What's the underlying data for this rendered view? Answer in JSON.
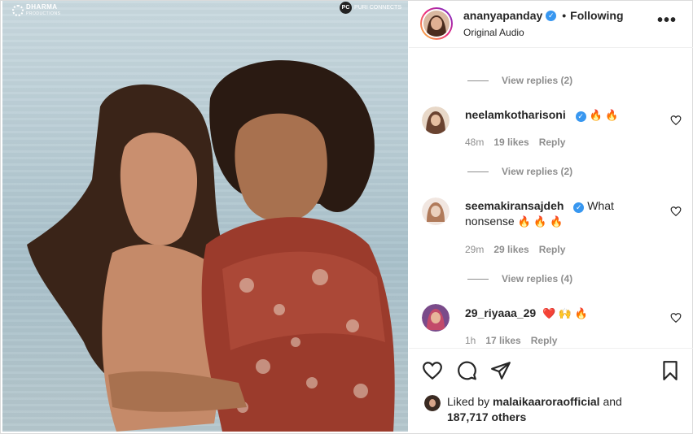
{
  "media": {
    "logo_left": "DHARMA",
    "logo_left_sub": "PRODUCTIONS",
    "logo_right_badge": "PC",
    "logo_right": "PURI CONNECTS"
  },
  "header": {
    "username": "ananyapanday",
    "follow_status": "Following",
    "audio": "Original Audio"
  },
  "comments": {
    "view_replies_top": "View replies (2)",
    "items": [
      {
        "username": "neelamkotharisoni",
        "text": "",
        "emoji": "🔥 🔥",
        "time": "48m",
        "likes": "19 likes",
        "reply": "Reply",
        "view_replies": "View replies (2)"
      },
      {
        "username": "seemakiransajdeh",
        "text": "What nonsense",
        "emoji": "🔥 🔥 🔥",
        "time": "29m",
        "likes": "29 likes",
        "reply": "Reply",
        "view_replies": "View replies (4)"
      },
      {
        "username": "29_riyaaa_29",
        "text": "",
        "emoji": "❤️ 🙌 🔥",
        "time": "1h",
        "likes": "17 likes",
        "reply": "Reply"
      }
    ]
  },
  "footer": {
    "liked_prefix": "Liked by",
    "liked_user": "malaikaaroraofficial",
    "liked_and": "and",
    "liked_others": "187,717 others"
  },
  "colors": {
    "verified": "#3897f0",
    "muted": "#8e8e8e",
    "text": "#262626",
    "heart_red": "#ed4956"
  },
  "icons": [
    "heart-icon",
    "comment-icon",
    "share-icon",
    "bookmark-icon",
    "more-icon",
    "verified-icon"
  ]
}
